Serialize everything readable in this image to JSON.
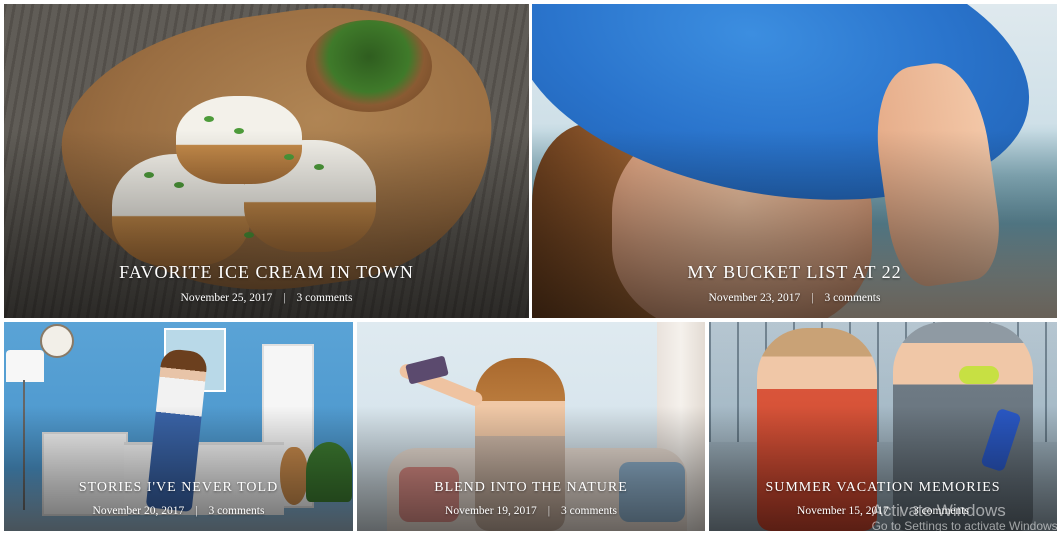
{
  "posts": [
    {
      "title": "FAVORITE ICE CREAM IN TOWN",
      "date": "November 25, 2017",
      "separator": "|",
      "comments": "3 comments"
    },
    {
      "title": "MY BUCKET LIST AT 22",
      "date": "November 23, 2017",
      "separator": "|",
      "comments": "3 comments"
    },
    {
      "title": "STORIES I'VE NEVER TOLD",
      "date": "November 20, 2017",
      "separator": "|",
      "comments": "3 comments"
    },
    {
      "title": "BLEND INTO THE NATURE",
      "date": "November 19, 2017",
      "separator": "|",
      "comments": "3 comments"
    },
    {
      "title": "SUMMER VACATION MEMORIES",
      "date": "November 15, 2017",
      "separator": "|",
      "comments": "3 comments"
    }
  ],
  "watermark": {
    "line1": "Activate Windows",
    "line2": "Go to Settings to activate Windows."
  }
}
